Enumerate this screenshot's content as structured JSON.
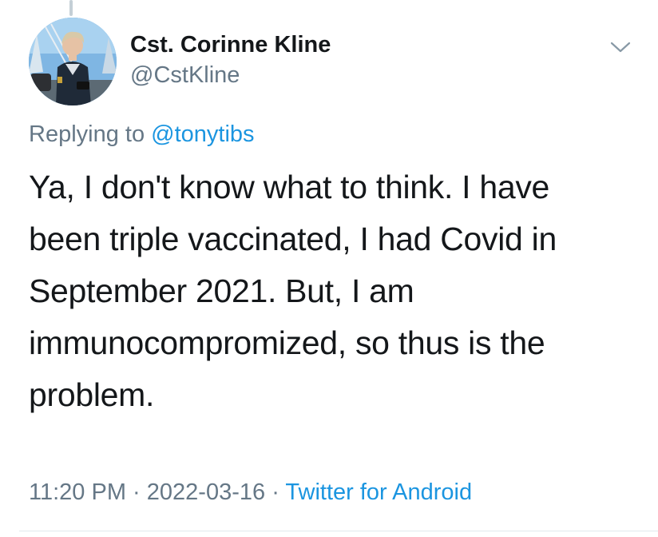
{
  "tweet": {
    "author": {
      "display_name": "Cst. Corinne Kline",
      "handle": "@CstKline"
    },
    "reply": {
      "prefix": "Replying to",
      "mention": "@tonytibs"
    },
    "text_lines": [
      "Ya, I don't know what to think. I have",
      "been triple vaccinated, I had Covid in",
      "September 2021. But, I am",
      "immunocompromized, so thus is the",
      "problem."
    ],
    "meta": {
      "time": "11:20 PM",
      "separator": "·",
      "date": "2022-03-16",
      "source": "Twitter for Android"
    },
    "menu_icon": "chevron-down-icon"
  },
  "colors": {
    "text": "#14171a",
    "secondary": "#657786",
    "link": "#1b95e0",
    "divider": "#e1e8ed"
  }
}
